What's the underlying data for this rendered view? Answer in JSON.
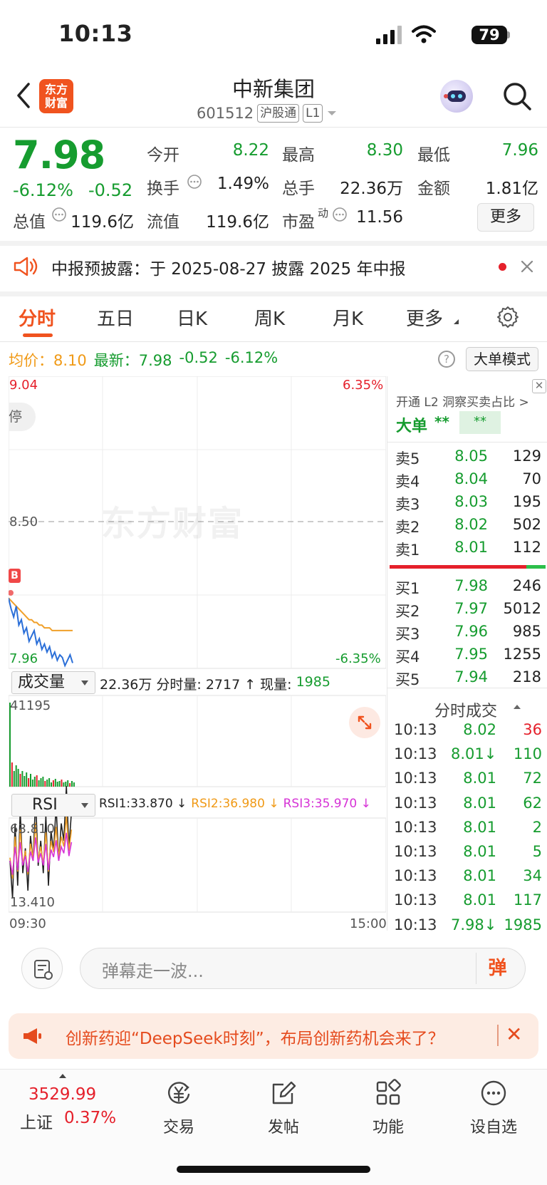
{
  "status": {
    "time": "10:13",
    "battery": "79"
  },
  "header": {
    "logo": [
      "东方",
      "财富"
    ],
    "name": "中新集团",
    "code": "601512",
    "tag_hk": "沪股通",
    "tag_level": "L1"
  },
  "quote": {
    "price": "7.98",
    "change_pct": "-6.12%",
    "change_amt": "-0.52",
    "fields": {
      "open_label": "今开",
      "open": "8.22",
      "high_label": "最高",
      "high": "8.30",
      "low_label": "最低",
      "low": "7.96",
      "turnover_label": "换手",
      "turnover": "1.49%",
      "volume_label": "总手",
      "volume": "22.36万",
      "amount_label": "金额",
      "amount": "1.81亿",
      "mktcap_label": "总值",
      "mktcap": "119.6亿",
      "float_label": "流值",
      "float": "119.6亿",
      "pe_label": "市盈",
      "pe_sup": "动",
      "pe": "11.56"
    },
    "more_btn": "更多"
  },
  "notice": {
    "text": "中报预披露：于 2025-08-27 披露 2025 年中报"
  },
  "tabs": [
    "分时",
    "五日",
    "日K",
    "周K",
    "月K",
    "更多"
  ],
  "info_row": {
    "avg_label": "均价：",
    "avg": "8.10",
    "last_label": "最新：",
    "last": "7.98",
    "chg": "-0.52",
    "pct": "-6.12%",
    "mode_btn": "大单模式"
  },
  "chart_axes": {
    "price_top": "9.04",
    "price_mid": "8.50",
    "price_bottom": "7.96",
    "pct_top": "6.35%",
    "pct_bottom": "-6.35%",
    "limit_tag": "停",
    "marker": "B",
    "vol_label": "成交量",
    "vol_stats": [
      "22.36万",
      "分时量: 2717 ↑",
      "现量:",
      "1985"
    ],
    "vol_max": "41195",
    "rsi_label": "RSI",
    "rsi1": "RSI1:33.870 ↓",
    "rsi2": "RSI2:36.980 ↓",
    "rsi3": "RSI3:35.970 ↓",
    "rsi_top": "63.810",
    "rsi_bottom": "13.410",
    "t_start": "09:30",
    "t_end": "15:00",
    "watermark": "东方财富"
  },
  "orderbook": {
    "l2_link": "开通 L2 洞察买卖占比 >",
    "big_label": "大单",
    "big_v1": "**",
    "big_v2": "**",
    "sells": [
      {
        "lbl": "卖5",
        "p": "8.05",
        "v": "129"
      },
      {
        "lbl": "卖4",
        "p": "8.04",
        "v": "70"
      },
      {
        "lbl": "卖3",
        "p": "8.03",
        "v": "195"
      },
      {
        "lbl": "卖2",
        "p": "8.02",
        "v": "502"
      },
      {
        "lbl": "卖1",
        "p": "8.01",
        "v": "112"
      }
    ],
    "buys": [
      {
        "lbl": "买1",
        "p": "7.98",
        "v": "246"
      },
      {
        "lbl": "买2",
        "p": "7.97",
        "v": "5012"
      },
      {
        "lbl": "买3",
        "p": "7.96",
        "v": "985"
      },
      {
        "lbl": "买4",
        "p": "7.95",
        "v": "1255"
      },
      {
        "lbl": "买5",
        "p": "7.94",
        "v": "218"
      }
    ],
    "ticks_title": "分时成交",
    "ticks": [
      {
        "t": "10:13",
        "p": "8.02",
        "v": "36",
        "pc": "green",
        "vc": "red"
      },
      {
        "t": "10:13",
        "p": "8.01↓",
        "v": "110",
        "pc": "green",
        "vc": "green"
      },
      {
        "t": "10:13",
        "p": "8.01",
        "v": "72",
        "pc": "green",
        "vc": "green"
      },
      {
        "t": "10:13",
        "p": "8.01",
        "v": "62",
        "pc": "green",
        "vc": "green"
      },
      {
        "t": "10:13",
        "p": "8.01",
        "v": "2",
        "pc": "green",
        "vc": "green"
      },
      {
        "t": "10:13",
        "p": "8.01",
        "v": "5",
        "pc": "green",
        "vc": "green"
      },
      {
        "t": "10:13",
        "p": "8.01",
        "v": "34",
        "pc": "green",
        "vc": "green"
      },
      {
        "t": "10:13",
        "p": "8.01",
        "v": "117",
        "pc": "green",
        "vc": "green"
      },
      {
        "t": "10:13",
        "p": "7.98↓",
        "v": "1985",
        "pc": "green",
        "vc": "green"
      }
    ]
  },
  "comment": {
    "placeholder": "弹幕走一波...",
    "send": "弹"
  },
  "promo": {
    "text": "创新药迎“DeepSeek时刻”，布局创新药机会来了？",
    "close": "✕"
  },
  "bottom_nav": {
    "index_value": "3529.99",
    "index_name": "上证",
    "index_pct": "0.37%",
    "items": [
      "交易",
      "发帖",
      "功能",
      "设自选"
    ]
  },
  "colors": {
    "down": "#169c2f",
    "up": "#e5202b",
    "accent": "#f0531f",
    "avg_line": "#f0a02a",
    "price_line": "#2b6fd8"
  }
}
